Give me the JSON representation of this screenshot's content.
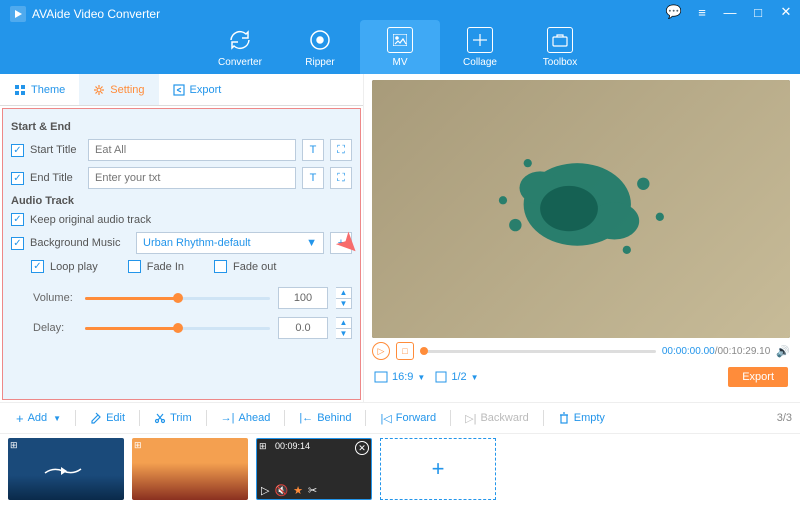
{
  "app": {
    "title": "AVAide Video Converter"
  },
  "nav": {
    "converter": "Converter",
    "ripper": "Ripper",
    "mv": "MV",
    "collage": "Collage",
    "toolbox": "Toolbox"
  },
  "subtabs": {
    "theme": "Theme",
    "setting": "Setting",
    "export": "Export"
  },
  "settings": {
    "start_end_label": "Start & End",
    "start_title_label": "Start Title",
    "start_title_value": "Eat All",
    "end_title_label": "End Title",
    "end_title_placeholder": "Enter your txt",
    "audio_track_label": "Audio Track",
    "keep_original_label": "Keep original audio track",
    "bg_music_label": "Background Music",
    "bg_music_value": "Urban Rhythm-default",
    "loop_label": "Loop play",
    "fade_in_label": "Fade In",
    "fade_out_label": "Fade out",
    "volume_label": "Volume:",
    "volume_value": "100",
    "delay_label": "Delay:",
    "delay_value": "0.0"
  },
  "player": {
    "current_time": "00:00:00.00",
    "duration": "/00:10:29.10",
    "aspect": "16:9",
    "zoom": "1/2",
    "export_label": "Export"
  },
  "tools": {
    "add": "Add",
    "edit": "Edit",
    "trim": "Trim",
    "ahead": "Ahead",
    "behind": "Behind",
    "forward": "Forward",
    "backward": "Backward",
    "empty": "Empty",
    "page": "3/3"
  },
  "thumbs": {
    "t3_time": "00:09:14"
  }
}
